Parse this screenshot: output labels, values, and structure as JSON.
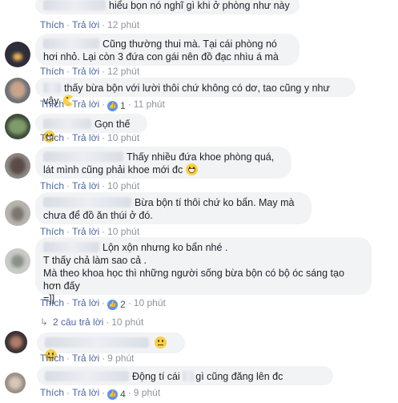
{
  "labels": {
    "like": "Thích",
    "reply": "Trả lời",
    "sep": "·"
  },
  "comments": [
    {
      "text": "hiểu bọn nó nghĩ gì khi ở phòng như này",
      "time": "12 phút"
    },
    {
      "text": "Cũng thường thui mà. Tại cái phòng nó hơi nhỏ. Lại còn 3 đứa con gái nên đồ đạc nhìu á mà",
      "time": "12 phút"
    },
    {
      "text": "thấy bừa bộn với lười thôi chứ không có dơ, tao cũng y như vậy",
      "likes": "1",
      "time": "11 phút"
    },
    {
      "text": "Gọn thế",
      "time": "10 phút"
    },
    {
      "text": "Thấy nhiều đứa khoe phòng quá, lát mình cũng phải khoe mới đc",
      "time": "10 phút"
    },
    {
      "text": "Bừa bộn tí thôi chứ ko bẩn. May mà chưa để đồ ăn thúi ở đó.",
      "time": "10 phút"
    },
    {
      "text_line1": "Lộn xộn nhưng ko bẩn nhé .",
      "text_line2": "T thấy chả làm sao cả .",
      "text_line3": "Mà theo khoa học thì những người sống bừa bộn có bộ óc sáng tạo hơn đấy",
      "text_line4": "=]]",
      "likes": "2",
      "time": "10 phút"
    }
  ],
  "replies_summary": {
    "label": "2 câu trả lời",
    "time": "10 phút"
  },
  "reply_comments": [
    {
      "text": "",
      "time": "9 phút"
    },
    {
      "text": "Động tí cái",
      "text_tail": "gì cũng đăng lên đc",
      "likes": "4",
      "time": "9 phút"
    }
  ],
  "colors": {
    "link": "#4b67a1",
    "bubble": "#f2f3f5",
    "like_badge": "#5890ff",
    "meta": "#90949c"
  }
}
